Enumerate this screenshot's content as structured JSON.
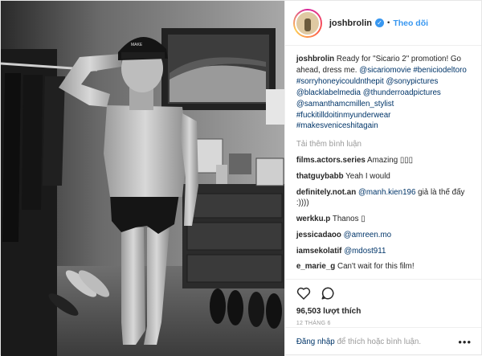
{
  "header": {
    "username": "joshbrolin",
    "verified_mark": "✓",
    "separator": "•",
    "follow_label": "Theo dõi"
  },
  "caption": {
    "user": "joshbrolin",
    "text": "Ready for \"Sicario 2\" promotion! Go ahead, dress me.",
    "tags": "@sicariomovie #beniciodeltoro #sorryhoneyicouldnthepit @sonypictures @blacklabelmedia @thunderroadpictures @samanthamcmillen_stylist #fuckitilldoitinmyunderwear #makesveniceshitagain"
  },
  "load_more": "Tải thêm bình luận",
  "comments": [
    {
      "user": "films.actors.series",
      "text": "Amazing ▯▯▯",
      "mention": ""
    },
    {
      "user": "thatguybabb",
      "text": "Yeah I would",
      "mention": ""
    },
    {
      "user": "definitely.not.an",
      "mention": "@manh.kien196",
      "text": " giả là thế đấy :))))"
    },
    {
      "user": "werkku.p",
      "text": "Thanos ▯",
      "mention": ""
    },
    {
      "user": "jessicadaoo",
      "mention": "@amreen.mo",
      "text": ""
    },
    {
      "user": "iamsekolatif",
      "mention": "@mdost911",
      "text": ""
    },
    {
      "user": "e_marie_g",
      "text": "Can't wait for this film!",
      "mention": ""
    }
  ],
  "likes": "96,503 lượt thích",
  "date": "12 THÁNG 6",
  "add_comment": {
    "login": "Đăng nhập",
    "rest": " để thích hoặc bình luận.",
    "more": "•••"
  },
  "colors": {
    "accent": "#3897f0",
    "link": "#003569"
  }
}
